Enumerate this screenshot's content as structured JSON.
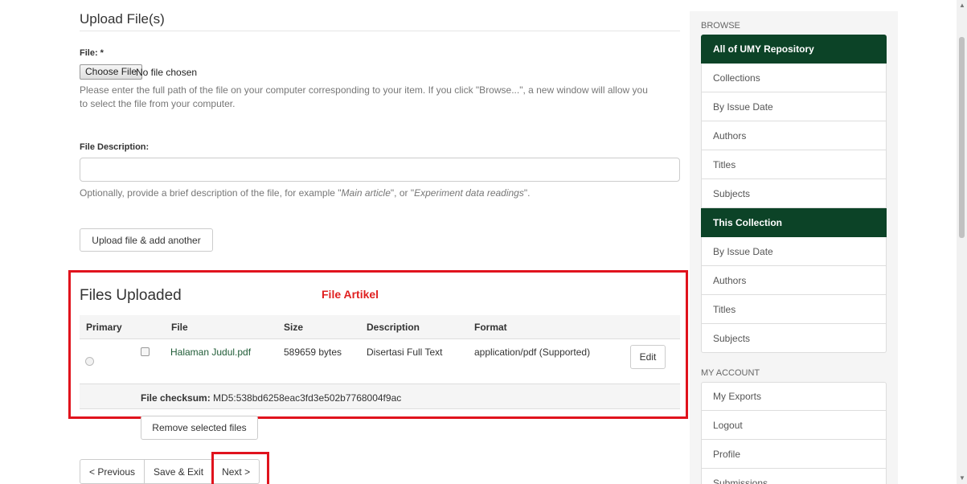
{
  "upload": {
    "title": "Upload File(s)",
    "file_label": "File: *",
    "choose_button": "Choose File",
    "no_file": "No file chosen",
    "file_help_1": "Please enter the full path of the file on your computer corresponding to your item. If you click \"Browse...\", a new window will allow you",
    "file_help_2": "to select the file from your computer.",
    "description_label": "File Description:",
    "description_value": "",
    "description_help_prefix": "Optionally, provide a brief description of the file, for example \"",
    "description_help_ex1": "Main article",
    "description_help_mid": "\", or \"",
    "description_help_ex2": "Experiment data readings",
    "description_help_suffix": "\".",
    "upload_button": "Upload file & add another"
  },
  "files": {
    "title": "Files Uploaded",
    "annotation": "File Artikel",
    "columns": [
      "Primary",
      "File",
      "Size",
      "Description",
      "Format"
    ],
    "rows": [
      {
        "file": "Halaman Judul.pdf",
        "size": "589659 bytes",
        "description": "Disertasi Full Text",
        "format": "application/pdf (Supported)",
        "edit": "Edit",
        "checksum_label": "File checksum:",
        "checksum_value": " MD5:538bd6258eac3fd3e502b7768004f9ac"
      }
    ],
    "remove_button": "Remove selected files"
  },
  "nav": {
    "previous": "< Previous",
    "save_exit": "Save & Exit",
    "next": "Next >"
  },
  "sidebar": {
    "browse_header": "BROWSE",
    "browse_items": [
      "All of UMY Repository",
      "Collections",
      "By Issue Date",
      "Authors",
      "Titles",
      "Subjects"
    ],
    "collection_items": [
      "This Collection",
      "By Issue Date",
      "Authors",
      "Titles",
      "Subjects"
    ],
    "account_header": "MY ACCOUNT",
    "account_items": [
      "My Exports",
      "Logout",
      "Profile",
      "Submissions"
    ]
  },
  "colors": {
    "accent": "#0c4327",
    "link": "#1f5b36",
    "annotation_red": "#e0131d"
  }
}
